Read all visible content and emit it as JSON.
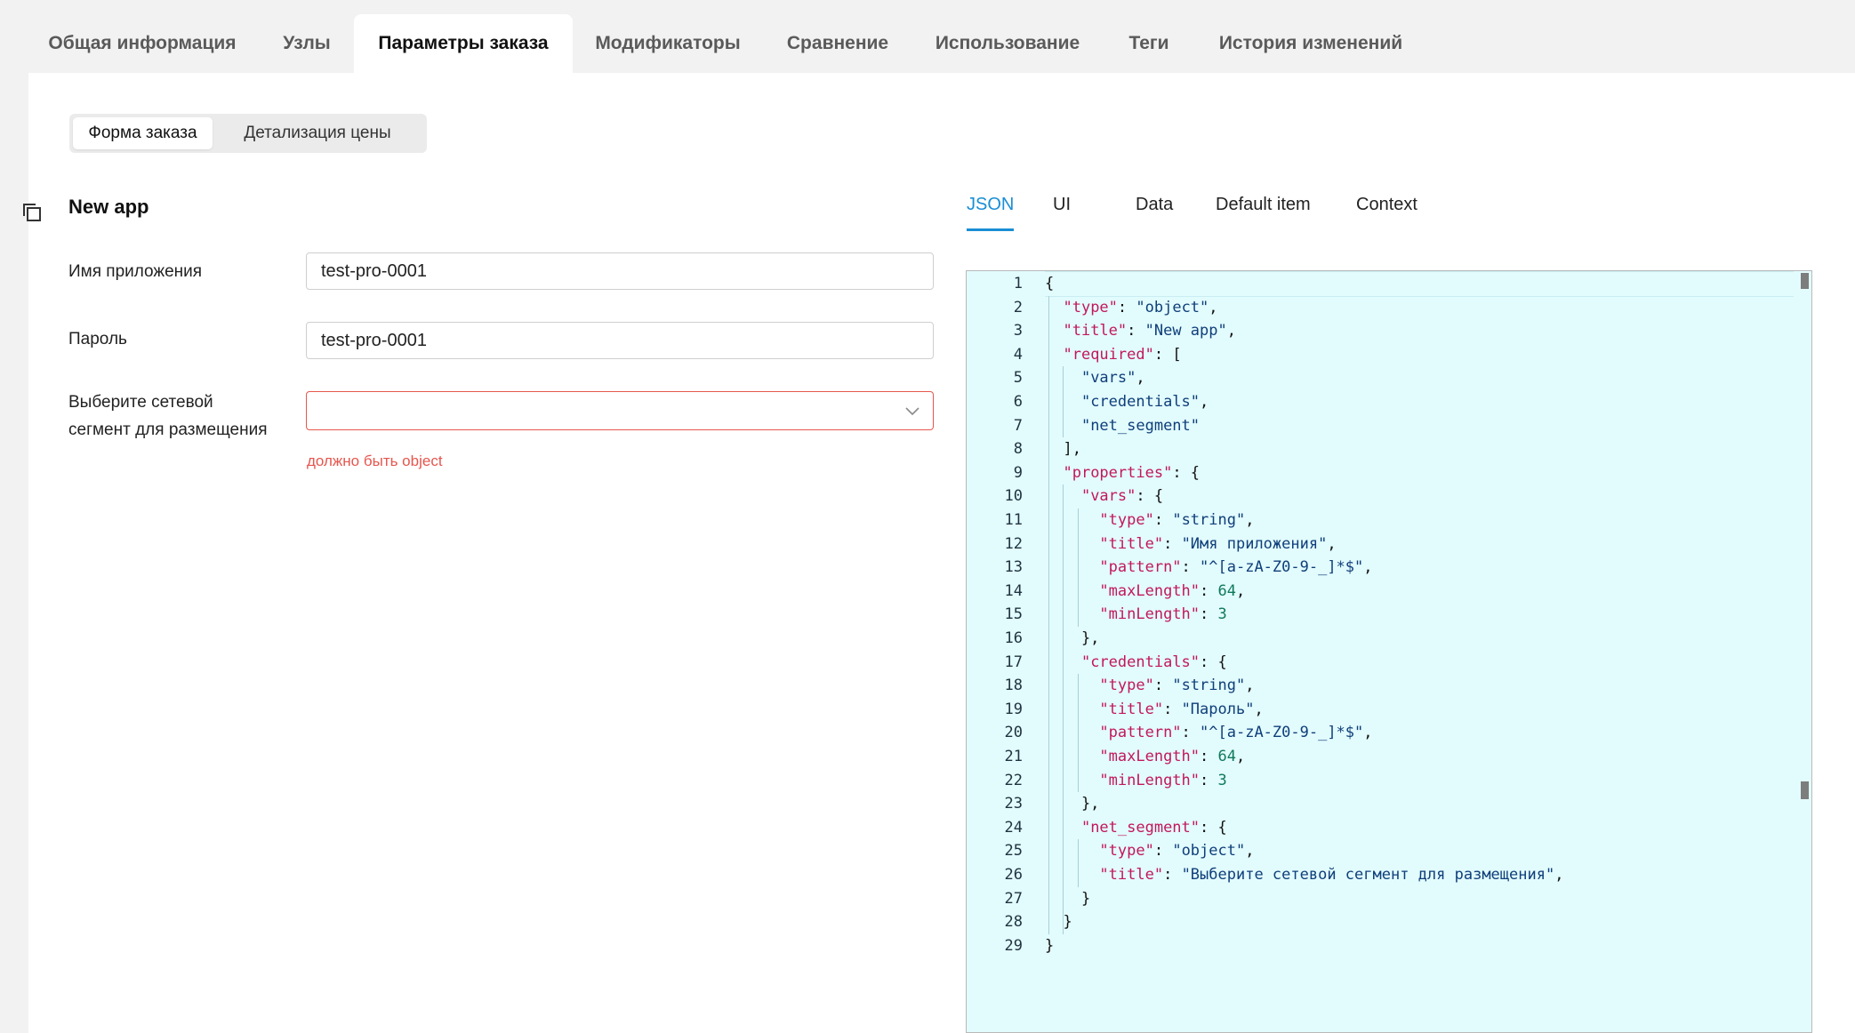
{
  "top_tabs": [
    {
      "label": "Общая информация",
      "active": false
    },
    {
      "label": "Узлы",
      "active": false
    },
    {
      "label": "Параметры заказа",
      "active": true
    },
    {
      "label": "Модификаторы",
      "active": false
    },
    {
      "label": "Сравнение",
      "active": false
    },
    {
      "label": "Использование",
      "active": false
    },
    {
      "label": "Теги",
      "active": false
    },
    {
      "label": "История изменений",
      "active": false
    }
  ],
  "segmented": {
    "order_form": "Форма заказа",
    "price_details": "Детализация цены"
  },
  "form": {
    "title": "New app",
    "app_name_label": "Имя приложения",
    "app_name_value": "test-pro-0001",
    "password_label": "Пароль",
    "password_value": "test-pro-0001",
    "segment_label_line1": "Выберите сетевой",
    "segment_label_line2": "сегмент для размещения",
    "segment_value": "",
    "segment_error": "должно быть object"
  },
  "editor_tabs": [
    {
      "label": "JSON",
      "active": true
    },
    {
      "label": "UI",
      "active": false
    },
    {
      "label": "Data",
      "active": false
    },
    {
      "label": "Default item",
      "active": false
    },
    {
      "label": "Context",
      "active": false
    }
  ],
  "editor": {
    "lines": [
      [
        {
          "t": "p",
          "v": "{"
        }
      ],
      [
        {
          "t": "p",
          "v": "  "
        },
        {
          "t": "k",
          "v": "\"type\""
        },
        {
          "t": "p",
          "v": ": "
        },
        {
          "t": "s",
          "v": "\"object\""
        },
        {
          "t": "p",
          "v": ","
        }
      ],
      [
        {
          "t": "p",
          "v": "  "
        },
        {
          "t": "k",
          "v": "\"title\""
        },
        {
          "t": "p",
          "v": ": "
        },
        {
          "t": "s",
          "v": "\"New app\""
        },
        {
          "t": "p",
          "v": ","
        }
      ],
      [
        {
          "t": "p",
          "v": "  "
        },
        {
          "t": "k",
          "v": "\"required\""
        },
        {
          "t": "p",
          "v": ": ["
        }
      ],
      [
        {
          "t": "p",
          "v": "    "
        },
        {
          "t": "s",
          "v": "\"vars\""
        },
        {
          "t": "p",
          "v": ","
        }
      ],
      [
        {
          "t": "p",
          "v": "    "
        },
        {
          "t": "s",
          "v": "\"credentials\""
        },
        {
          "t": "p",
          "v": ","
        }
      ],
      [
        {
          "t": "p",
          "v": "    "
        },
        {
          "t": "s",
          "v": "\"net_segment\""
        }
      ],
      [
        {
          "t": "p",
          "v": "  ],"
        }
      ],
      [
        {
          "t": "p",
          "v": "  "
        },
        {
          "t": "k",
          "v": "\"properties\""
        },
        {
          "t": "p",
          "v": ": {"
        }
      ],
      [
        {
          "t": "p",
          "v": "    "
        },
        {
          "t": "k",
          "v": "\"vars\""
        },
        {
          "t": "p",
          "v": ": {"
        }
      ],
      [
        {
          "t": "p",
          "v": "      "
        },
        {
          "t": "k",
          "v": "\"type\""
        },
        {
          "t": "p",
          "v": ": "
        },
        {
          "t": "s",
          "v": "\"string\""
        },
        {
          "t": "p",
          "v": ","
        }
      ],
      [
        {
          "t": "p",
          "v": "      "
        },
        {
          "t": "k",
          "v": "\"title\""
        },
        {
          "t": "p",
          "v": ": "
        },
        {
          "t": "s",
          "v": "\"Имя приложения\""
        },
        {
          "t": "p",
          "v": ","
        }
      ],
      [
        {
          "t": "p",
          "v": "      "
        },
        {
          "t": "k",
          "v": "\"pattern\""
        },
        {
          "t": "p",
          "v": ": "
        },
        {
          "t": "s",
          "v": "\"^[a-zA-Z0-9-_]*$\""
        },
        {
          "t": "p",
          "v": ","
        }
      ],
      [
        {
          "t": "p",
          "v": "      "
        },
        {
          "t": "k",
          "v": "\"maxLength\""
        },
        {
          "t": "p",
          "v": ": "
        },
        {
          "t": "n",
          "v": "64"
        },
        {
          "t": "p",
          "v": ","
        }
      ],
      [
        {
          "t": "p",
          "v": "      "
        },
        {
          "t": "k",
          "v": "\"minLength\""
        },
        {
          "t": "p",
          "v": ": "
        },
        {
          "t": "n",
          "v": "3"
        }
      ],
      [
        {
          "t": "p",
          "v": "    },"
        }
      ],
      [
        {
          "t": "p",
          "v": "    "
        },
        {
          "t": "k",
          "v": "\"credentials\""
        },
        {
          "t": "p",
          "v": ": {"
        }
      ],
      [
        {
          "t": "p",
          "v": "      "
        },
        {
          "t": "k",
          "v": "\"type\""
        },
        {
          "t": "p",
          "v": ": "
        },
        {
          "t": "s",
          "v": "\"string\""
        },
        {
          "t": "p",
          "v": ","
        }
      ],
      [
        {
          "t": "p",
          "v": "      "
        },
        {
          "t": "k",
          "v": "\"title\""
        },
        {
          "t": "p",
          "v": ": "
        },
        {
          "t": "s",
          "v": "\"Пароль\""
        },
        {
          "t": "p",
          "v": ","
        }
      ],
      [
        {
          "t": "p",
          "v": "      "
        },
        {
          "t": "k",
          "v": "\"pattern\""
        },
        {
          "t": "p",
          "v": ": "
        },
        {
          "t": "s",
          "v": "\"^[a-zA-Z0-9-_]*$\""
        },
        {
          "t": "p",
          "v": ","
        }
      ],
      [
        {
          "t": "p",
          "v": "      "
        },
        {
          "t": "k",
          "v": "\"maxLength\""
        },
        {
          "t": "p",
          "v": ": "
        },
        {
          "t": "n",
          "v": "64"
        },
        {
          "t": "p",
          "v": ","
        }
      ],
      [
        {
          "t": "p",
          "v": "      "
        },
        {
          "t": "k",
          "v": "\"minLength\""
        },
        {
          "t": "p",
          "v": ": "
        },
        {
          "t": "n",
          "v": "3"
        }
      ],
      [
        {
          "t": "p",
          "v": "    },"
        }
      ],
      [
        {
          "t": "p",
          "v": "    "
        },
        {
          "t": "k",
          "v": "\"net_segment\""
        },
        {
          "t": "p",
          "v": ": {"
        }
      ],
      [
        {
          "t": "p",
          "v": "      "
        },
        {
          "t": "k",
          "v": "\"type\""
        },
        {
          "t": "p",
          "v": ": "
        },
        {
          "t": "s",
          "v": "\"object\""
        },
        {
          "t": "p",
          "v": ","
        }
      ],
      [
        {
          "t": "p",
          "v": "      "
        },
        {
          "t": "k",
          "v": "\"title\""
        },
        {
          "t": "p",
          "v": ": "
        },
        {
          "t": "s",
          "v": "\"Выберите сетевой сегмент для размещения\""
        },
        {
          "t": "p",
          "v": ","
        }
      ],
      [
        {
          "t": "p",
          "v": "    }"
        }
      ],
      [
        {
          "t": "p",
          "v": "  }"
        }
      ],
      [
        {
          "t": "p",
          "v": "}"
        }
      ]
    ]
  },
  "colors": {
    "accent": "#1a8ed4",
    "error": "#e6564e",
    "editor_bg": "#e2fbfd",
    "json_key": "#c2185b",
    "json_string": "#0f3f7a",
    "json_number": "#0e7a5a"
  },
  "icons": {
    "copy": "copy-icon",
    "dropdown": "chevron-down-icon"
  }
}
